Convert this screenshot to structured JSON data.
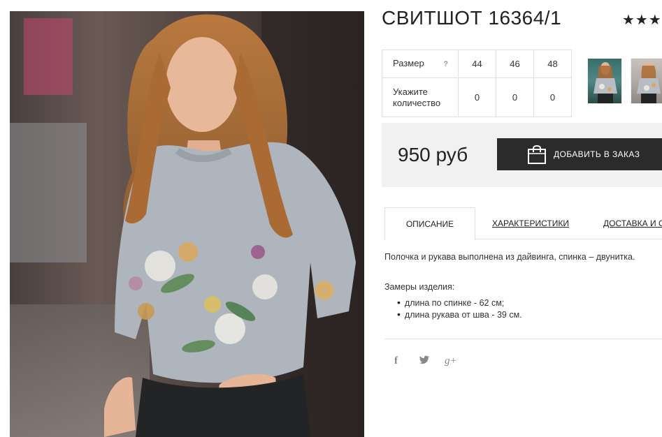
{
  "product": {
    "title": "СВИТШОТ 16364/1",
    "rating_stars": "★★★★"
  },
  "size_table": {
    "size_label": "Размер",
    "help_icon": "?",
    "sizes": [
      "44",
      "46",
      "48"
    ],
    "qty_label": "Укажите количество",
    "quantities": [
      "0",
      "0",
      "0"
    ]
  },
  "price": {
    "amount": "950 руб",
    "order_button": "ДОБАВИТЬ В ЗАКАЗ"
  },
  "tabs": [
    {
      "label": "ОПИСАНИЕ",
      "active": true
    },
    {
      "label": "ХАРАКТЕРИСТИКИ",
      "active": false
    },
    {
      "label": "ДОСТАВКА И ОПЛАТА",
      "active": false
    }
  ],
  "description": {
    "text": "Полочка и рукава выполнена из дайвинга, спинка – двунитка.",
    "measures_title": "Замеры изделия:",
    "measures": [
      "длина по спинке - 62 см;",
      "длина рукава от шва - 39 см."
    ]
  },
  "social": {
    "facebook": "f",
    "twitter": "t",
    "google_plus": "g+"
  },
  "colors": {
    "dark": "#2b2b2b",
    "price_bg": "#f1f1f1",
    "border": "#e0e0e0"
  }
}
